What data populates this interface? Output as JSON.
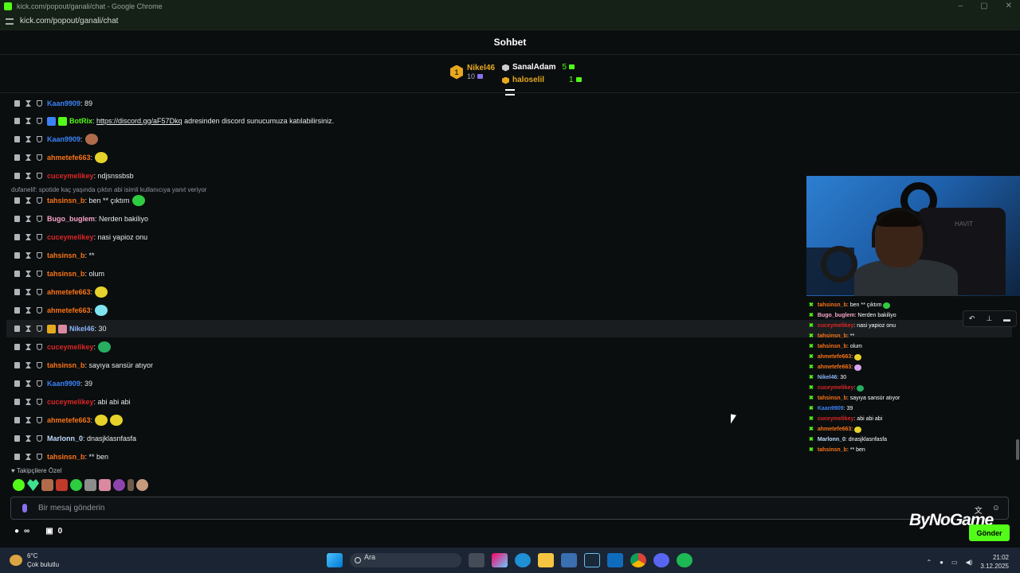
{
  "window": {
    "title": "kick.com/popout/ganali/chat - Google Chrome",
    "url": "kick.com/popout/ganali/chat"
  },
  "chat_header": {
    "title": "Sohbet"
  },
  "leaderboard": {
    "first": {
      "rank": "1",
      "name": "Nikel46",
      "count": "10"
    },
    "others": [
      {
        "name": "SanalAdam",
        "count": "5"
      },
      {
        "name": "haloselil",
        "count": "1"
      }
    ]
  },
  "messages": [
    {
      "user": "Kaan9909",
      "color": "#3b82f6",
      "text": ": 89",
      "emotes": []
    },
    {
      "user": "BotRix",
      "color": "#53fc18",
      "link": "https://discord.gg/aF57Dkq",
      "text": " adresinden discord sunucumuza katılabilirsiniz.",
      "emotes": [],
      "badges": [
        "bot-badge",
        "verified-badge"
      ]
    },
    {
      "user": "Kaan9909",
      "color": "#3b82f6",
      "text": ":",
      "emotes": [
        "face-emote"
      ]
    },
    {
      "user": "ahmetefe663",
      "color": "#f97316",
      "text": ":",
      "emotes": [
        "yellow-emote"
      ]
    },
    {
      "user": "cuceymelikey",
      "color": "#dc2626",
      "text": ": ndjsnssbsb",
      "emotes": []
    },
    {
      "user": "tahsinsn_b",
      "color": "#f97316",
      "text": ": ben ** çıktım",
      "emotes": [
        "green-emote"
      ]
    },
    {
      "user": "Bugo_buglem",
      "color": "#f8a4c8",
      "text": ": Nerden bakiliyo",
      "emotes": []
    },
    {
      "user": "cuceymelikey",
      "color": "#dc2626",
      "text": ": nasi yapioz onu",
      "emotes": []
    },
    {
      "user": "tahsinsn_b",
      "color": "#f97316",
      "text": ": **",
      "emotes": []
    },
    {
      "user": "tahsinsn_b",
      "color": "#f97316",
      "text": ": olum",
      "emotes": []
    },
    {
      "user": "ahmetefe663",
      "color": "#f97316",
      "text": ":",
      "emotes": [
        "yellow-emote"
      ]
    },
    {
      "user": "ahmetefe663",
      "color": "#f97316",
      "text": ":",
      "emotes": [
        "blue-emote"
      ]
    },
    {
      "user": "Nikel46",
      "color": "#8ab4f8",
      "text": ": 30",
      "emotes": [],
      "badges": [
        "crown-badge",
        "gift-badge"
      ]
    },
    {
      "user": "cuceymelikey",
      "color": "#dc2626",
      "text": ":",
      "emotes": [
        "globe-emote"
      ]
    },
    {
      "user": "tahsinsn_b",
      "color": "#f97316",
      "text": ": sayıya sansür atıyor",
      "emotes": []
    },
    {
      "user": "Kaan9909",
      "color": "#3b82f6",
      "text": ": 39",
      "emotes": []
    },
    {
      "user": "cuceymelikey",
      "color": "#dc2626",
      "text": ": abi abi abi",
      "emotes": []
    },
    {
      "user": "ahmetefe663",
      "color": "#f97316",
      "text": ":",
      "emotes": [
        "yellow-emote",
        "yellow-emote"
      ]
    },
    {
      "user": "Marlonn_0",
      "color": "#bfdbfe",
      "text": ": dnasjklasnfasfa",
      "emotes": []
    },
    {
      "user": "tahsinsn_b",
      "color": "#f97316",
      "text": ": ** ben",
      "emotes": []
    }
  ],
  "reply_indicator": "dufanelif: spotide kaç yaşında çıktın abi isimli kullanıcıya yanıt veriyor",
  "follower_only": "Takipçilere Özel",
  "composer": {
    "placeholder": "Bir mesaj gönderin"
  },
  "stats": {
    "infinity": "∞",
    "count": "0"
  },
  "send_button": "Gönder",
  "watermark": "ByNoGame",
  "overlay_chat": [
    {
      "user": "tahsinsn_b",
      "color": "#f97316",
      "text": ": ben ** çıktım",
      "emote": "green"
    },
    {
      "user": "Bugo_buglem",
      "color": "#f8a4c8",
      "text": ": Nerden bakiliyo"
    },
    {
      "user": "cuceymelikey",
      "color": "#dc2626",
      "text": ": nasi yapioz onu"
    },
    {
      "user": "tahsinsn_b",
      "color": "#f97316",
      "text": ": **"
    },
    {
      "user": "tahsinsn_b",
      "color": "#f97316",
      "text": ": olum"
    },
    {
      "user": "ahmetefe663",
      "color": "#f97316",
      "text": ":",
      "emote": "yellow"
    },
    {
      "user": "ahmetefe663",
      "color": "#f97316",
      "text": ":",
      "emote": "blue"
    },
    {
      "user": "Nikel46",
      "color": "#8ab4f8",
      "text": ": 30"
    },
    {
      "user": "cuceymelikey",
      "color": "#dc2626",
      "text": ":",
      "emote": "globe"
    },
    {
      "user": "tahsinsn_b",
      "color": "#f97316",
      "text": ": sayıya sansür atıyor"
    },
    {
      "user": "Kaan9909",
      "color": "#3b82f6",
      "text": ": 39"
    },
    {
      "user": "cuceymelikey",
      "color": "#dc2626",
      "text": ": abi abi abi"
    },
    {
      "user": "ahmetefe663",
      "color": "#f97316",
      "text": ":",
      "emote": "yellow"
    },
    {
      "user": "Marlonn_0",
      "color": "#bfdbfe",
      "text": ": dnasjklasnfasfa"
    },
    {
      "user": "tahsinsn_b",
      "color": "#f97316",
      "text": ": ** ben"
    }
  ],
  "webcam": {
    "chair_logo": "HAVIT"
  },
  "taskbar": {
    "temperature": "6°C",
    "weather": "Çok bulutlu",
    "search": "Ara",
    "time": "21:02",
    "date": "3.12.2025"
  },
  "colors": {
    "accent": "#53fc18",
    "background": "#0b0e0f",
    "gold": "#e6a91e"
  }
}
